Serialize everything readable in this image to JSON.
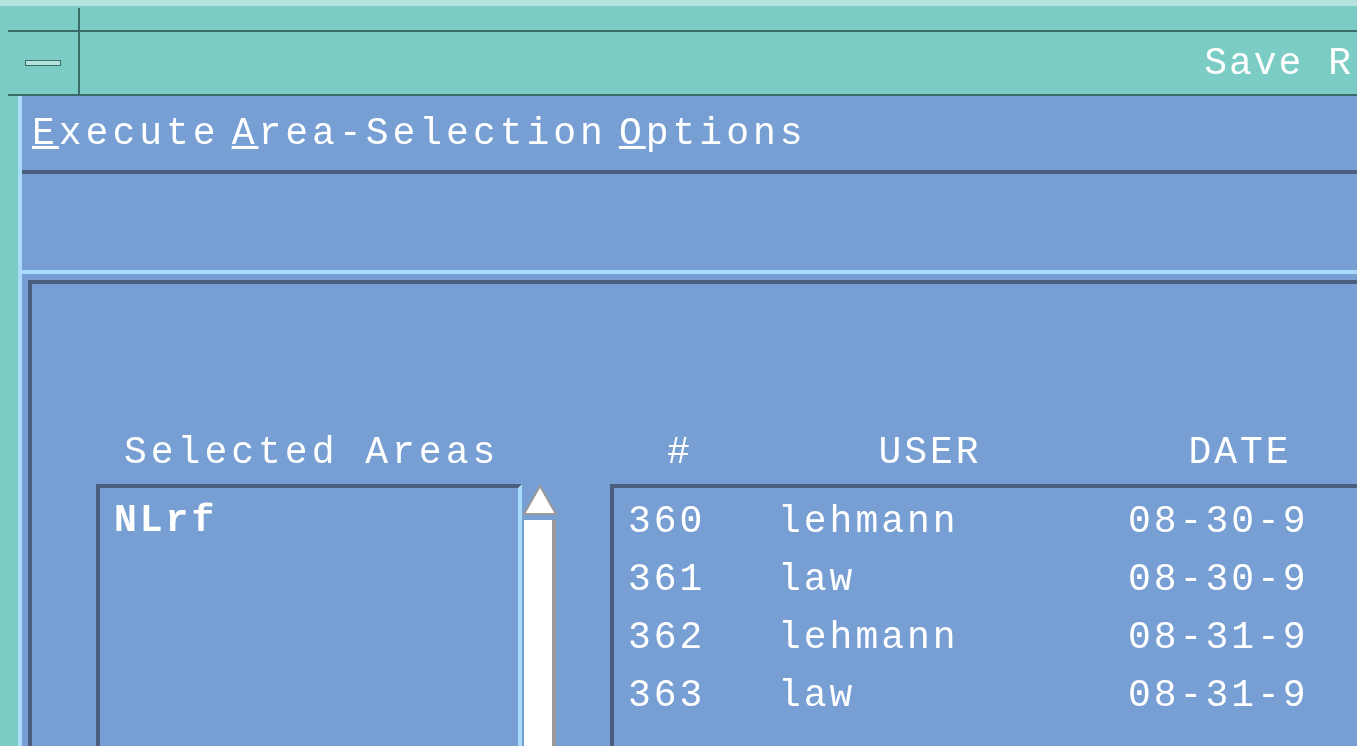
{
  "window": {
    "title": "Save R"
  },
  "menu": [
    "Execute",
    "Area-Selection",
    "Options"
  ],
  "selected_areas": {
    "label": "Selected Areas",
    "items": [
      "NLrf"
    ]
  },
  "table": {
    "columns": [
      "#",
      "USER",
      "DATE"
    ],
    "rows": [
      [
        "360",
        "lehmann",
        "08-30-9"
      ],
      [
        "361",
        "law",
        "08-30-9"
      ],
      [
        "362",
        "lehmann",
        "08-31-9"
      ],
      [
        "363",
        "law",
        "08-31-9"
      ]
    ]
  }
}
